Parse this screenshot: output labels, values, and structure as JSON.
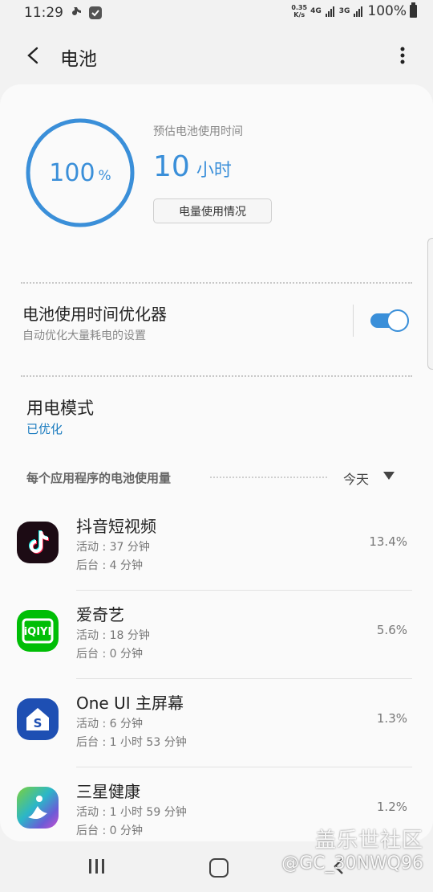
{
  "status_bar": {
    "time": "11:29",
    "net_speed_value": "0.35",
    "net_speed_unit": "K/s",
    "signal_4g": "4G",
    "signal_3g": "3G",
    "battery_text": "100%"
  },
  "header": {
    "title": "电池"
  },
  "battery": {
    "level_value": "100",
    "level_unit": "%",
    "level_fraction": 1.0,
    "estimate_label": "预估电池使用时间",
    "estimate_value": "10",
    "estimate_unit": "小时",
    "usage_button": "电量使用情况"
  },
  "optimizer": {
    "title": "电池使用时间优化器",
    "subtitle": "自动优化大量耗电的设置",
    "enabled": true
  },
  "power_mode": {
    "title": "用电模式",
    "value": "已优化"
  },
  "app_usage": {
    "label": "每个应用程序的电池使用量",
    "filter": "今天",
    "apps": [
      {
        "name": "抖音短视频",
        "active": "活动 : 37 分钟",
        "background": "后台 : 4 分钟",
        "percent": "13.4%",
        "icon": "douyin-icon"
      },
      {
        "name": "爱奇艺",
        "active": "活动 : 18 分钟",
        "background": "后台 : 0 分钟",
        "percent": "5.6%",
        "icon": "iqiyi-icon"
      },
      {
        "name": "One UI 主屏幕",
        "active": "活动 : 6 分钟",
        "background": "后台 : 1 小时 53 分钟",
        "percent": "1.3%",
        "icon": "oneui-home-icon"
      },
      {
        "name": "三星健康",
        "active": "活动 : 1 小时 59 分钟",
        "background": "后台 : 0 分钟",
        "percent": "1.2%",
        "icon": "samsung-health-icon"
      }
    ]
  },
  "watermark": {
    "line1": "盖乐世社区",
    "line2": "@GC_30NWQ96"
  },
  "colors": {
    "accent": "#3a8fd9",
    "link": "#1a7bbf"
  }
}
